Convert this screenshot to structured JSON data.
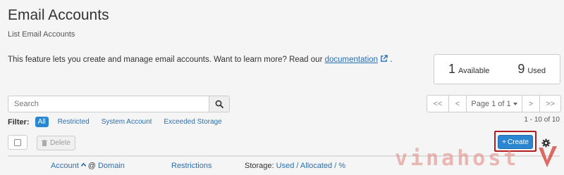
{
  "header": {
    "title": "Email Accounts",
    "subtitle": "List Email Accounts"
  },
  "intro": {
    "text": "This feature lets you create and manage email accounts. Want to learn more? Read our ",
    "link_label": "documentation",
    "suffix": " ."
  },
  "stats": {
    "available_count": "1",
    "available_label": "Available",
    "used_count": "9",
    "used_label": "Used"
  },
  "search": {
    "placeholder": "Search",
    "value": ""
  },
  "pagination": {
    "first": "<<",
    "prev": "<",
    "page_label": "Page 1 of 1",
    "next": ">",
    "last": ">>",
    "range_text": "1 - 10 of 10"
  },
  "filter": {
    "label": "Filter:",
    "options": [
      "All",
      "Restricted",
      "System Account",
      "Exceeded Storage"
    ],
    "selected": "All"
  },
  "actions": {
    "delete_label": "Delete",
    "create_label": "Create"
  },
  "table": {
    "col_account": "Account",
    "col_at": "@",
    "col_domain": "Domain",
    "col_restrictions": "Restrictions",
    "col_storage_prefix": "Storage:",
    "col_storage_used": "Used",
    "col_storage_sep1": "/",
    "col_storage_allocated": "Allocated",
    "col_storage_sep2": "/",
    "col_storage_pct": "%"
  },
  "watermark": {
    "text": "vinahost"
  },
  "colors": {
    "accent": "#2a86d1",
    "link": "#2a6fb0",
    "highlight_border": "#b01e22",
    "watermark": "#de8278"
  }
}
